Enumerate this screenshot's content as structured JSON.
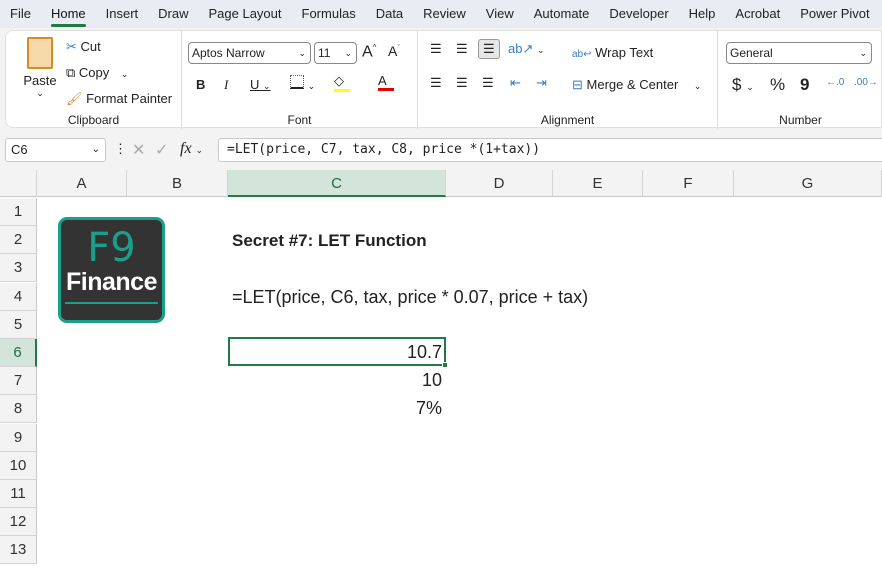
{
  "menu_tabs": [
    "File",
    "Home",
    "Insert",
    "Draw",
    "Page Layout",
    "Formulas",
    "Data",
    "Review",
    "View",
    "Automate",
    "Developer",
    "Help",
    "Acrobat",
    "Power Pivot"
  ],
  "active_tab": "Home",
  "clipboard": {
    "paste": "Paste",
    "cut": "Cut",
    "copy": "Copy",
    "format_painter": "Format Painter",
    "label": "Clipboard"
  },
  "font": {
    "name": "Aptos Narrow",
    "size": "11",
    "bold": "B",
    "italic": "I",
    "underline": "U",
    "label": "Font",
    "fill_color": "#ffff00",
    "font_color": "#e00000"
  },
  "alignment": {
    "wrap_text": "Wrap Text",
    "merge_center": "Merge & Center",
    "label": "Alignment"
  },
  "number": {
    "format": "General",
    "currency": "$",
    "percent": "%",
    "comma": "9",
    "label": "Number"
  },
  "formula_bar": {
    "name_box": "C6",
    "fx": "fx",
    "formula": "=LET(price, C7, tax, C8, price *(1+tax))"
  },
  "columns": [
    "A",
    "B",
    "C",
    "D",
    "E",
    "F",
    "G"
  ],
  "selected_column": "C",
  "rows": [
    "1",
    "2",
    "3",
    "4",
    "5",
    "6",
    "7",
    "8",
    "9",
    "10",
    "11",
    "12",
    "13"
  ],
  "selected_row": "6",
  "logo": {
    "line1": "F9",
    "line2": "Finance"
  },
  "cells": {
    "C2": "Secret #7: LET Function",
    "C4": "=LET(price, C6, tax, price * 0.07, price + tax)",
    "C6": "10.7",
    "C7": "10",
    "C8": "7%"
  },
  "colors": {
    "accent": "#1f7a45",
    "logo_bg": "#333333",
    "logo_teal": "#1aa08a"
  }
}
